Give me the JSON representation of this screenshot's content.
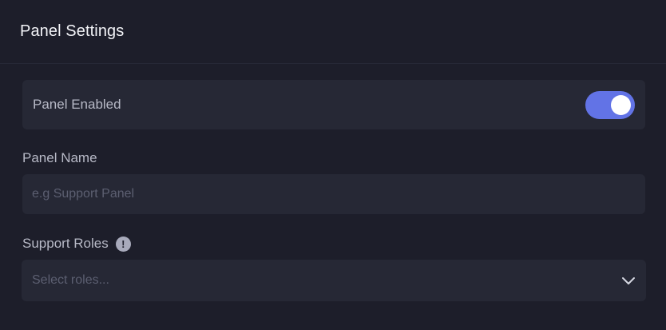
{
  "header": {
    "title": "Panel Settings"
  },
  "toggle": {
    "label": "Panel Enabled",
    "enabled": true,
    "accent_color": "#6273e6"
  },
  "panel_name": {
    "label": "Panel Name",
    "value": "",
    "placeholder": "e.g Support Panel"
  },
  "support_roles": {
    "label": "Support Roles",
    "info_icon": "!",
    "placeholder": "Select roles..."
  }
}
